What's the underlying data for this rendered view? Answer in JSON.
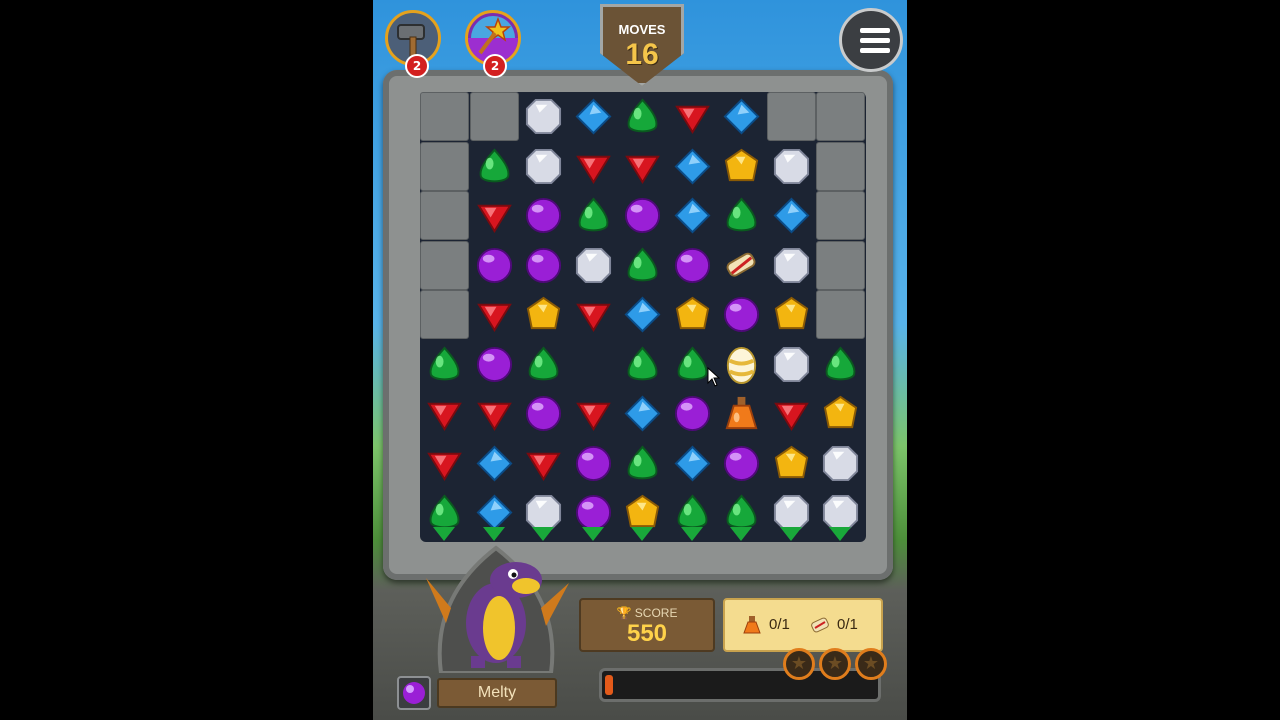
{
  "hud": {
    "moves_label": "MOVES",
    "moves_value": "16",
    "booster_hammer_count": "2",
    "booster_wand_count": "2",
    "menu_icon": "hamburger-menu-icon"
  },
  "score": {
    "label": "SCORE",
    "value": "550",
    "progress_fraction": 0.03,
    "stars_earned": 0,
    "stars_total": 3
  },
  "goals": [
    {
      "icon": "potion-icon",
      "text": "0/1"
    },
    {
      "icon": "scroll-icon",
      "text": "0/1"
    }
  ],
  "pet": {
    "name": "Melty",
    "gem_color": "purple"
  },
  "colors": {
    "red": "#d8151f",
    "blue": "#2e9be8",
    "green": "#16a83a",
    "purple": "#9a1fd6",
    "yellow": "#f3b510",
    "white": "#d8dbe6"
  },
  "board": {
    "rows": [
      [
        "X",
        "X",
        "white",
        "blue",
        "green",
        "red",
        "blue",
        "X",
        "X"
      ],
      [
        "X",
        "green",
        "white",
        "red",
        "red",
        "blue",
        "yellow",
        "white",
        "X"
      ],
      [
        "X",
        "red",
        "purple",
        "green",
        "purple",
        "blue",
        "green",
        "blue",
        "X"
      ],
      [
        "X",
        "purple",
        "purple",
        "white",
        "green",
        "purple",
        "scroll",
        "white",
        "X"
      ],
      [
        "X",
        "red",
        "yellow",
        "red",
        "blue",
        "yellow",
        "purple",
        "yellow",
        "X"
      ],
      [
        "green",
        "purple",
        "green",
        "_",
        "green",
        "green",
        "egg",
        "white",
        "green"
      ],
      [
        "red",
        "red",
        "purple",
        "red",
        "blue",
        "purple",
        "potion",
        "red",
        "yellow"
      ],
      [
        "red",
        "blue",
        "red",
        "purple",
        "green",
        "blue",
        "purple",
        "yellow",
        "white"
      ],
      [
        "green",
        "blue",
        "white",
        "purple",
        "yellow",
        "green",
        "green",
        "white",
        "white"
      ]
    ]
  }
}
